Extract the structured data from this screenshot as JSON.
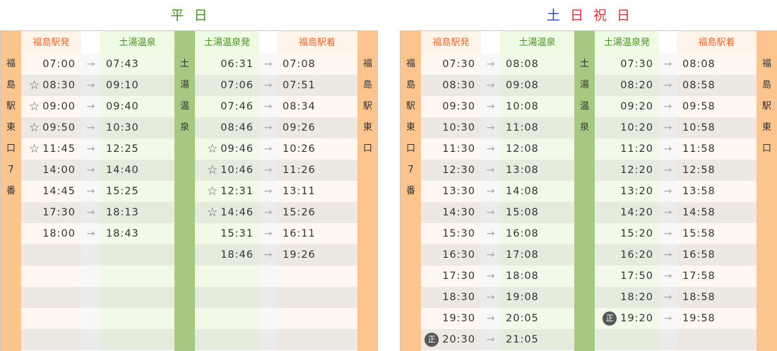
{
  "weekday": {
    "title_chars": [
      "平",
      "日"
    ],
    "stop_left": [
      "福",
      "島",
      "駅",
      "東",
      "口",
      "7",
      "番"
    ],
    "stop_right": [
      "福",
      "島",
      "駅",
      "東",
      "口"
    ],
    "onsen_band": [
      "土",
      "湯",
      "温",
      "泉"
    ],
    "headers": {
      "out_dep": "福島駅発",
      "out_arr": "土湯温泉",
      "ret_dep": "土湯温泉発",
      "ret_arr": "福島駅着"
    },
    "outbound": [
      {
        "mark": "",
        "dep": "07:00",
        "arr": "07:43"
      },
      {
        "mark": "star",
        "dep": "08:30",
        "arr": "09:10"
      },
      {
        "mark": "star",
        "dep": "09:00",
        "arr": "09:40"
      },
      {
        "mark": "star",
        "dep": "09:50",
        "arr": "10:30"
      },
      {
        "mark": "star",
        "dep": "11:45",
        "arr": "12:25"
      },
      {
        "mark": "",
        "dep": "14:00",
        "arr": "14:40"
      },
      {
        "mark": "",
        "dep": "14:45",
        "arr": "15:25"
      },
      {
        "mark": "",
        "dep": "17:30",
        "arr": "18:13"
      },
      {
        "mark": "",
        "dep": "18:00",
        "arr": "18:43"
      }
    ],
    "return": [
      {
        "mark": "",
        "dep": "06:31",
        "arr": "07:08"
      },
      {
        "mark": "",
        "dep": "07:06",
        "arr": "07:51"
      },
      {
        "mark": "",
        "dep": "07:46",
        "arr": "08:34"
      },
      {
        "mark": "",
        "dep": "08:46",
        "arr": "09:26"
      },
      {
        "mark": "star",
        "dep": "09:46",
        "arr": "10:26"
      },
      {
        "mark": "star",
        "dep": "10:46",
        "arr": "11:26"
      },
      {
        "mark": "star",
        "dep": "12:31",
        "arr": "13:11"
      },
      {
        "mark": "star",
        "dep": "14:46",
        "arr": "15:26"
      },
      {
        "mark": "",
        "dep": "15:31",
        "arr": "16:11"
      },
      {
        "mark": "",
        "dep": "18:46",
        "arr": "19:26"
      }
    ],
    "row_count": 14
  },
  "holiday": {
    "title_chars": [
      "土",
      "日",
      "祝",
      "日"
    ],
    "stop_left": [
      "福",
      "島",
      "駅",
      "東",
      "口",
      "7",
      "番"
    ],
    "stop_right": [
      "福",
      "島",
      "駅",
      "東",
      "口"
    ],
    "onsen_band": [
      "土",
      "湯",
      "温",
      "泉"
    ],
    "headers": {
      "out_dep": "福島駅発",
      "out_arr": "土湯温泉",
      "ret_dep": "土湯温泉発",
      "ret_arr": "福島駅着"
    },
    "outbound": [
      {
        "mark": "",
        "dep": "07:30",
        "arr": "08:08"
      },
      {
        "mark": "",
        "dep": "08:30",
        "arr": "09:08"
      },
      {
        "mark": "",
        "dep": "09:30",
        "arr": "10:08"
      },
      {
        "mark": "",
        "dep": "10:30",
        "arr": "11:08"
      },
      {
        "mark": "",
        "dep": "11:30",
        "arr": "12:08"
      },
      {
        "mark": "",
        "dep": "12:30",
        "arr": "13:08"
      },
      {
        "mark": "",
        "dep": "13:30",
        "arr": "14:08"
      },
      {
        "mark": "",
        "dep": "14:30",
        "arr": "15:08"
      },
      {
        "mark": "",
        "dep": "15:30",
        "arr": "16:08"
      },
      {
        "mark": "",
        "dep": "16:30",
        "arr": "17:08"
      },
      {
        "mark": "",
        "dep": "17:30",
        "arr": "18:08"
      },
      {
        "mark": "",
        "dep": "18:30",
        "arr": "19:08"
      },
      {
        "mark": "",
        "dep": "19:30",
        "arr": "20:05"
      },
      {
        "mark": "badge",
        "dep": "20:30",
        "arr": "21:05"
      }
    ],
    "return": [
      {
        "mark": "",
        "dep": "07:30",
        "arr": "08:08"
      },
      {
        "mark": "",
        "dep": "08:20",
        "arr": "08:58"
      },
      {
        "mark": "",
        "dep": "09:20",
        "arr": "09:58"
      },
      {
        "mark": "",
        "dep": "10:20",
        "arr": "10:58"
      },
      {
        "mark": "",
        "dep": "11:20",
        "arr": "11:58"
      },
      {
        "mark": "",
        "dep": "12:20",
        "arr": "12:58"
      },
      {
        "mark": "",
        "dep": "13:20",
        "arr": "13:58"
      },
      {
        "mark": "",
        "dep": "14:20",
        "arr": "14:58"
      },
      {
        "mark": "",
        "dep": "15:20",
        "arr": "15:58"
      },
      {
        "mark": "",
        "dep": "16:20",
        "arr": "16:58"
      },
      {
        "mark": "",
        "dep": "17:50",
        "arr": "17:58"
      },
      {
        "mark": "",
        "dep": "18:20",
        "arr": "18:58"
      },
      {
        "mark": "badge",
        "dep": "19:20",
        "arr": "19:58"
      }
    ],
    "row_count": 14
  },
  "symbols": {
    "arrow": "→",
    "star": "☆",
    "badge": "正"
  },
  "colors": {
    "weekday_title": "#3f8f1f",
    "holiday_title_sat": "#2447b8",
    "holiday_title_red": "#d8303a",
    "stop_band": "#fcc48e",
    "onsen_band": "#a6c982",
    "header_orange": "#e2682a",
    "header_green": "#4a8f22",
    "badge": "#575757"
  }
}
